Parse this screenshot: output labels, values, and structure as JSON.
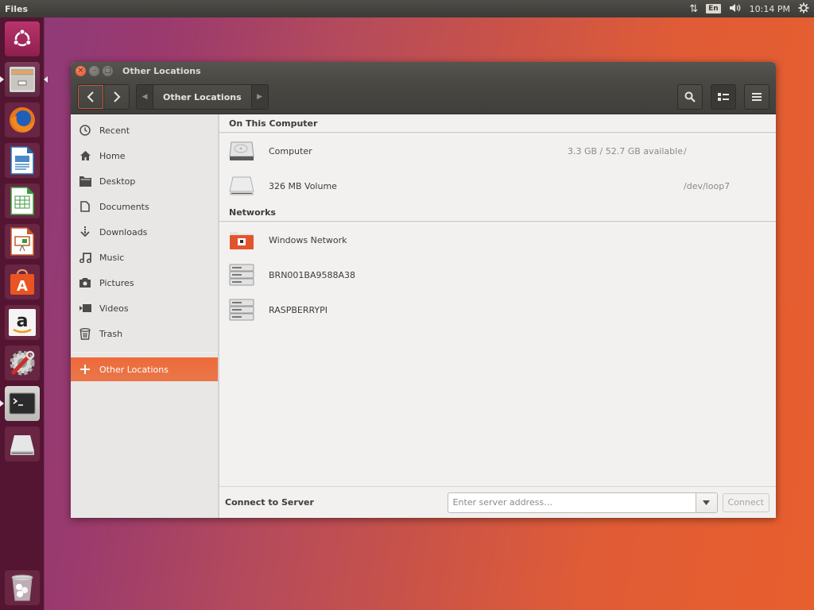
{
  "top_panel": {
    "app_name": "Files",
    "icons": [
      "network-transfer-icon",
      "keyboard-layout-icon",
      "volume-icon",
      "power-gear-icon"
    ],
    "keyboard_layout": "En",
    "clock": "10:14 PM"
  },
  "launcher": {
    "items": [
      {
        "name": "ubuntu-dash",
        "label": "Search your computer"
      },
      {
        "name": "files",
        "label": "Files",
        "running": true,
        "focused": true
      },
      {
        "name": "firefox",
        "label": "Firefox Web Browser"
      },
      {
        "name": "libreoffice-writer",
        "label": "LibreOffice Writer"
      },
      {
        "name": "libreoffice-calc",
        "label": "LibreOffice Calc"
      },
      {
        "name": "libreoffice-impress",
        "label": "LibreOffice Impress"
      },
      {
        "name": "ubuntu-software",
        "label": "Ubuntu Software"
      },
      {
        "name": "amazon",
        "label": "Amazon"
      },
      {
        "name": "system-settings",
        "label": "System Settings"
      },
      {
        "name": "terminal",
        "label": "Terminal",
        "running": true
      },
      {
        "name": "removable-drive",
        "label": "326 MB Volume"
      },
      {
        "name": "trash",
        "label": "Trash"
      }
    ]
  },
  "window": {
    "title": "Other Locations",
    "header": {
      "back_label": "<",
      "forward_label": ">",
      "breadcrumb": "Other Locations",
      "search_icon": "search-icon",
      "view_icon": "list-view-icon",
      "menu_icon": "hamburger-menu-icon"
    },
    "sidebar": {
      "items": [
        {
          "label": "Recent",
          "icon": "clock-icon"
        },
        {
          "label": "Home",
          "icon": "home-icon"
        },
        {
          "label": "Desktop",
          "icon": "folder-icon"
        },
        {
          "label": "Documents",
          "icon": "document-icon"
        },
        {
          "label": "Downloads",
          "icon": "download-icon"
        },
        {
          "label": "Music",
          "icon": "music-icon"
        },
        {
          "label": "Pictures",
          "icon": "camera-icon"
        },
        {
          "label": "Videos",
          "icon": "video-icon"
        },
        {
          "label": "Trash",
          "icon": "trash-icon"
        }
      ],
      "other_locations": {
        "label": "Other Locations",
        "icon": "plus-icon",
        "selected": true
      }
    },
    "sections": {
      "computer": {
        "title": "On This Computer",
        "items": [
          {
            "name": "Computer",
            "space": "3.3 GB / 52.7 GB available",
            "path": "/",
            "icon": "hard-disk-icon"
          },
          {
            "name": "326 MB Volume",
            "space": "",
            "path": "/dev/loop7",
            "icon": "removable-drive-icon"
          }
        ]
      },
      "networks": {
        "title": "Networks",
        "items": [
          {
            "name": "Windows Network",
            "icon": "network-folder-icon"
          },
          {
            "name": "BRN001BA9588A38",
            "icon": "network-server-icon"
          },
          {
            "name": "RASPBERRYPI",
            "icon": "network-server-icon"
          }
        ]
      }
    },
    "connect": {
      "label": "Connect to Server",
      "placeholder": "Enter server address…",
      "value": "",
      "button": "Connect"
    }
  },
  "colors": {
    "accent": "#e95420",
    "selection": "#ee6a3a",
    "headerbar": "#45443f",
    "panel": "#3c3b37"
  }
}
